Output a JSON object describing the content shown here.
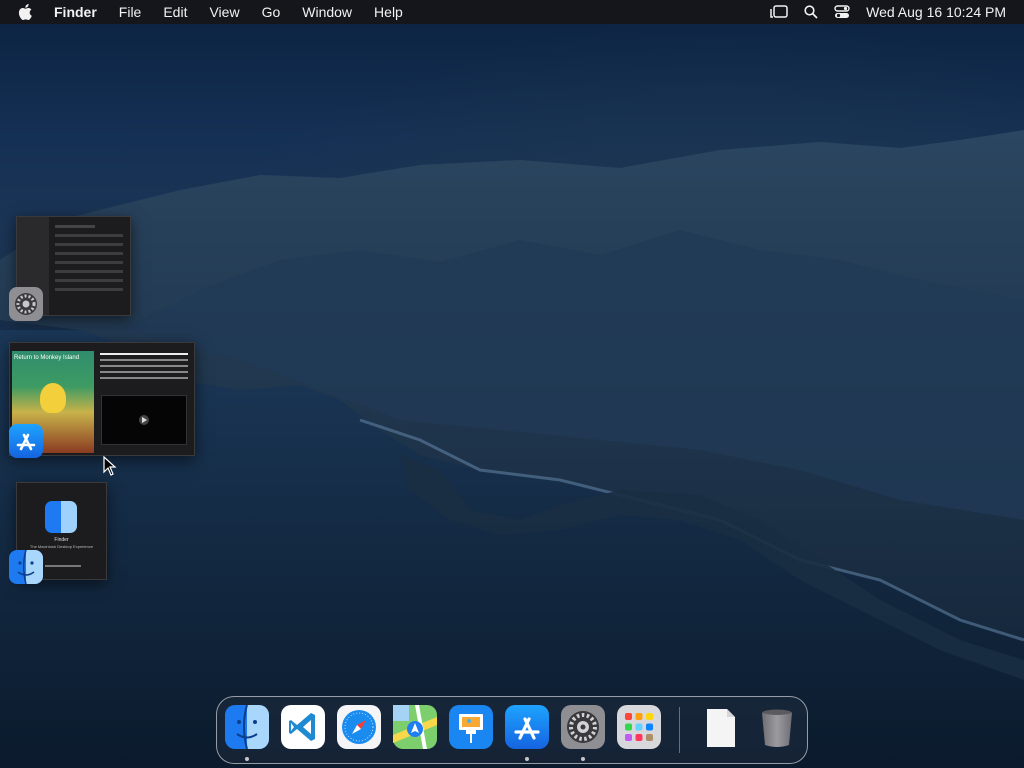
{
  "menubar": {
    "apple_icon": "apple-icon",
    "items": [
      "Finder",
      "File",
      "Edit",
      "View",
      "Go",
      "Window",
      "Help"
    ],
    "status_icons": [
      "stage-manager-icon",
      "search-icon",
      "control-center-icon"
    ],
    "clock": "Wed Aug 16  10:24 PM"
  },
  "stage_manager": {
    "groups": [
      {
        "app": "System Settings",
        "icon": "system-settings-icon"
      },
      {
        "app": "App Store",
        "icon": "app-store-icon",
        "thumb_title": "Return to Monkey Island"
      },
      {
        "app": "Finder",
        "icon": "finder-icon",
        "thumb_title": "Finder",
        "thumb_subtitle": "The Macintosh Desktop Experience"
      }
    ]
  },
  "dock": {
    "apps": [
      {
        "name": "Finder",
        "icon": "finder-icon",
        "running": true
      },
      {
        "name": "Visual Studio Code",
        "icon": "vscode-icon",
        "running": false
      },
      {
        "name": "Safari",
        "icon": "safari-icon",
        "running": false
      },
      {
        "name": "Maps",
        "icon": "maps-icon",
        "running": false
      },
      {
        "name": "Keynote",
        "icon": "keynote-icon",
        "running": false
      },
      {
        "name": "App Store",
        "icon": "app-store-icon",
        "running": true
      },
      {
        "name": "System Settings",
        "icon": "system-settings-icon",
        "running": true
      },
      {
        "name": "Launchpad",
        "icon": "launchpad-icon",
        "running": false
      },
      {
        "name": "Document",
        "icon": "document-icon",
        "running": false
      },
      {
        "name": "Trash",
        "icon": "trash-icon",
        "running": false
      }
    ]
  },
  "colors": {
    "menubar_bg": "#161618",
    "accent_blue": "#1e88e5",
    "wallpaper_top": "#0c2240",
    "wallpaper_bottom": "#0a1828"
  }
}
